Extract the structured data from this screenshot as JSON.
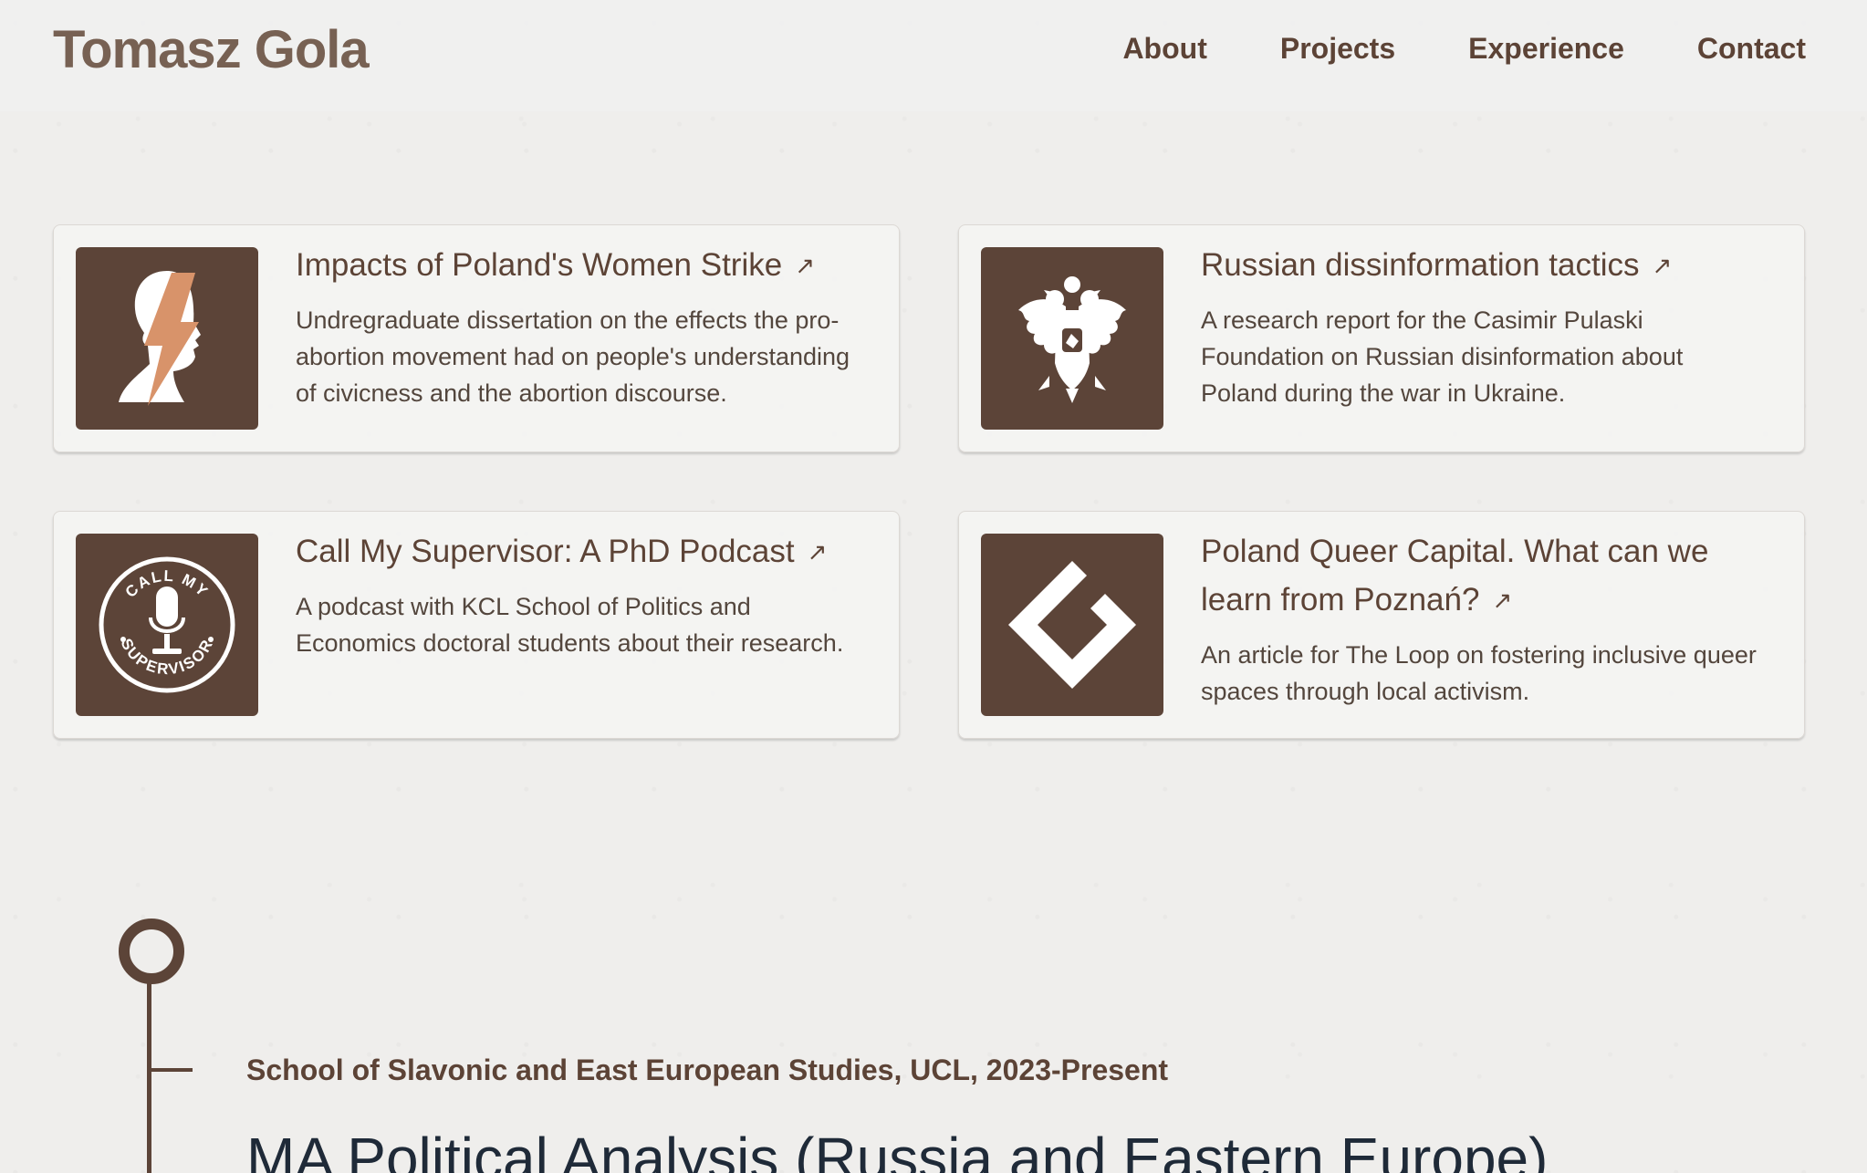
{
  "header": {
    "brand": "Tomasz Gola",
    "nav": [
      "About",
      "Projects",
      "Experience",
      "Contact"
    ]
  },
  "projects": [
    {
      "title": "Impacts of Poland's Women Strike",
      "description": "Undregraduate dissertation on the effects the pro-abortion movement had on people's understanding of civicness and the abortion discourse.",
      "icon": "women-strike-icon"
    },
    {
      "title": "Russian dissinformation tactics",
      "description": "A research report for the Casimir Pulaski Foundation on Russian disinformation about Poland during the war in Ukraine.",
      "icon": "double-headed-eagle-icon"
    },
    {
      "title": "Call My Supervisor: A PhD Podcast",
      "description": "A podcast with KCL School of Politics and Economics doctoral students about their research.",
      "icon": "podcast-logo-icon",
      "logo_text_top": "CALL MY",
      "logo_text_bottom": "SUPERVISOR"
    },
    {
      "title": "Poland Queer Capital. What can we learn from Poznań?",
      "description": "An article for The Loop on fostering inclusive queer spaces through local activism.",
      "icon": "diamond-logo-icon"
    }
  ],
  "arrow_glyph": "↗",
  "experience": {
    "meta": "School of Slavonic and East European Studies, UCL, 2023-Present",
    "title": "MA Political Analysis (Russia and Eastern Europe)"
  },
  "colors": {
    "accent": "#5c4438",
    "brand_text": "#776153",
    "strike_bolt": "#d8936a",
    "background": "#efeeec"
  }
}
